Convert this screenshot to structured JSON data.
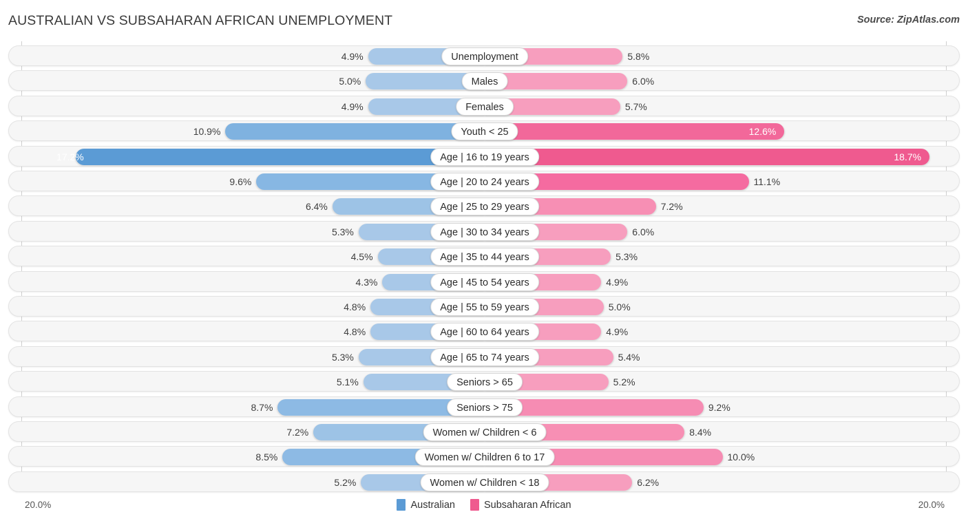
{
  "header": {
    "title": "AUSTRALIAN VS SUBSAHARAN AFRICAN UNEMPLOYMENT",
    "source": "Source: ZipAtlas.com"
  },
  "axis": {
    "left_tick": "20.0%",
    "right_tick": "20.0%",
    "max": 20.0
  },
  "legend": {
    "items": [
      {
        "label": "Australian",
        "color": "#5b9bd5"
      },
      {
        "label": "Subsaharan African",
        "color": "#ef5a8f"
      }
    ]
  },
  "colors": {
    "left_normal": "#a8c8e8",
    "left_max": "#5b9bd5",
    "right_normal": "#f79ebe",
    "right_max": "#f3burn",
    "right_high": "#f26d9c",
    "right_peak": "#ef5a8f",
    "row_bg": "#f6f6f6",
    "row_border": "#e3e3e3"
  },
  "chart_data": {
    "type": "bar",
    "subtype": "diverging-paired-bar",
    "title": "AUSTRALIAN VS SUBSAHARAN AFRICAN UNEMPLOYMENT",
    "xlabel": "",
    "ylabel": "",
    "xlim": [
      20.0,
      20.0
    ],
    "grid": false,
    "legend_position": "bottom-center",
    "categories": [
      "Unemployment",
      "Males",
      "Females",
      "Youth < 25",
      "Age | 16 to 19 years",
      "Age | 20 to 24 years",
      "Age | 25 to 29 years",
      "Age | 30 to 34 years",
      "Age | 35 to 44 years",
      "Age | 45 to 54 years",
      "Age | 55 to 59 years",
      "Age | 60 to 64 years",
      "Age | 65 to 74 years",
      "Seniors > 65",
      "Seniors > 75",
      "Women w/ Children < 6",
      "Women w/ Children 6 to 17",
      "Women w/ Children < 18"
    ],
    "series": [
      {
        "name": "Australian",
        "side": "left",
        "values": [
          4.9,
          5.0,
          4.9,
          10.9,
          17.2,
          9.6,
          6.4,
          5.3,
          4.5,
          4.3,
          4.8,
          4.8,
          5.3,
          5.1,
          8.7,
          7.2,
          8.5,
          5.2
        ],
        "labels": [
          "4.9%",
          "5.0%",
          "4.9%",
          "10.9%",
          "17.2%",
          "9.6%",
          "6.4%",
          "5.3%",
          "4.5%",
          "4.3%",
          "4.8%",
          "4.8%",
          "5.3%",
          "5.1%",
          "8.7%",
          "7.2%",
          "8.5%",
          "5.2%"
        ]
      },
      {
        "name": "Subsaharan African",
        "side": "right",
        "values": [
          5.8,
          6.0,
          5.7,
          12.6,
          18.7,
          11.1,
          7.2,
          6.0,
          5.3,
          4.9,
          5.0,
          4.9,
          5.4,
          5.2,
          9.2,
          8.4,
          10.0,
          6.2
        ],
        "labels": [
          "5.8%",
          "6.0%",
          "5.7%",
          "12.6%",
          "18.7%",
          "11.1%",
          "7.2%",
          "6.0%",
          "5.3%",
          "4.9%",
          "5.0%",
          "4.9%",
          "5.4%",
          "5.2%",
          "9.2%",
          "8.4%",
          "10.0%",
          "6.2%"
        ]
      }
    ]
  },
  "rows": [
    {
      "label": "Unemployment",
      "left": "4.9%",
      "right": "5.8%",
      "lv": 4.9,
      "rv": 5.8,
      "lin": false,
      "rin": false,
      "lc": "#a8c8e8",
      "rc": "#f79ebe"
    },
    {
      "label": "Males",
      "left": "5.0%",
      "right": "6.0%",
      "lv": 5.0,
      "rv": 6.0,
      "lin": false,
      "rin": false,
      "lc": "#a8c8e8",
      "rc": "#f79ebe"
    },
    {
      "label": "Females",
      "left": "4.9%",
      "right": "5.7%",
      "lv": 4.9,
      "rv": 5.7,
      "lin": false,
      "rin": false,
      "lc": "#a8c8e8",
      "rc": "#f79ebe"
    },
    {
      "label": "Youth < 25",
      "left": "10.9%",
      "right": "12.6%",
      "lv": 10.9,
      "rv": 12.6,
      "lin": false,
      "rin": true,
      "lc": "#7fb2e0",
      "rc": "#f2689a"
    },
    {
      "label": "Age | 16 to 19 years",
      "left": "17.2%",
      "right": "18.7%",
      "lv": 17.2,
      "rv": 18.7,
      "lin": true,
      "rin": true,
      "lc": "#5b9bd5",
      "rc": "#ef5a8f"
    },
    {
      "label": "Age | 20 to 24 years",
      "left": "9.6%",
      "right": "11.1%",
      "lv": 9.6,
      "rv": 11.1,
      "lin": false,
      "rin": false,
      "lc": "#87b7e3",
      "rc": "#f56ba0"
    },
    {
      "label": "Age | 25 to 29 years",
      "left": "6.4%",
      "right": "7.2%",
      "lv": 6.4,
      "rv": 7.2,
      "lin": false,
      "rin": false,
      "lc": "#9dc3e6",
      "rc": "#f78fb4"
    },
    {
      "label": "Age | 30 to 34 years",
      "left": "5.3%",
      "right": "6.0%",
      "lv": 5.3,
      "rv": 6.0,
      "lin": false,
      "rin": false,
      "lc": "#a8c8e8",
      "rc": "#f79ebe"
    },
    {
      "label": "Age | 35 to 44 years",
      "left": "4.5%",
      "right": "5.3%",
      "lv": 4.5,
      "rv": 5.3,
      "lin": false,
      "rin": false,
      "lc": "#a8c8e8",
      "rc": "#f79ebe"
    },
    {
      "label": "Age | 45 to 54 years",
      "left": "4.3%",
      "right": "4.9%",
      "lv": 4.3,
      "rv": 4.9,
      "lin": false,
      "rin": false,
      "lc": "#a8c8e8",
      "rc": "#f79ebe"
    },
    {
      "label": "Age | 55 to 59 years",
      "left": "4.8%",
      "right": "5.0%",
      "lv": 4.8,
      "rv": 5.0,
      "lin": false,
      "rin": false,
      "lc": "#a8c8e8",
      "rc": "#f79ebe"
    },
    {
      "label": "Age | 60 to 64 years",
      "left": "4.8%",
      "right": "4.9%",
      "lv": 4.8,
      "rv": 4.9,
      "lin": false,
      "rin": false,
      "lc": "#a8c8e8",
      "rc": "#f79ebe"
    },
    {
      "label": "Age | 65 to 74 years",
      "left": "5.3%",
      "right": "5.4%",
      "lv": 5.3,
      "rv": 5.4,
      "lin": false,
      "rin": false,
      "lc": "#a8c8e8",
      "rc": "#f79ebe"
    },
    {
      "label": "Seniors > 65",
      "left": "5.1%",
      "right": "5.2%",
      "lv": 5.1,
      "rv": 5.2,
      "lin": false,
      "rin": false,
      "lc": "#a8c8e8",
      "rc": "#f79ebe"
    },
    {
      "label": "Seniors > 75",
      "left": "8.7%",
      "right": "9.2%",
      "lv": 8.7,
      "rv": 9.2,
      "lin": false,
      "rin": false,
      "lc": "#8dbae4",
      "rc": "#f68cb3"
    },
    {
      "label": "Women w/ Children < 6",
      "left": "7.2%",
      "right": "8.4%",
      "lv": 7.2,
      "rv": 8.4,
      "lin": false,
      "rin": false,
      "lc": "#9dc3e6",
      "rc": "#f78fb4"
    },
    {
      "label": "Women w/ Children 6 to 17",
      "left": "8.5%",
      "right": "10.0%",
      "lv": 8.5,
      "rv": 10.0,
      "lin": false,
      "rin": false,
      "lc": "#8dbae4",
      "rc": "#f68cb3"
    },
    {
      "label": "Women w/ Children < 18",
      "left": "5.2%",
      "right": "6.2%",
      "lv": 5.2,
      "rv": 6.2,
      "lin": false,
      "rin": false,
      "lc": "#a8c8e8",
      "rc": "#f79ebe"
    }
  ]
}
